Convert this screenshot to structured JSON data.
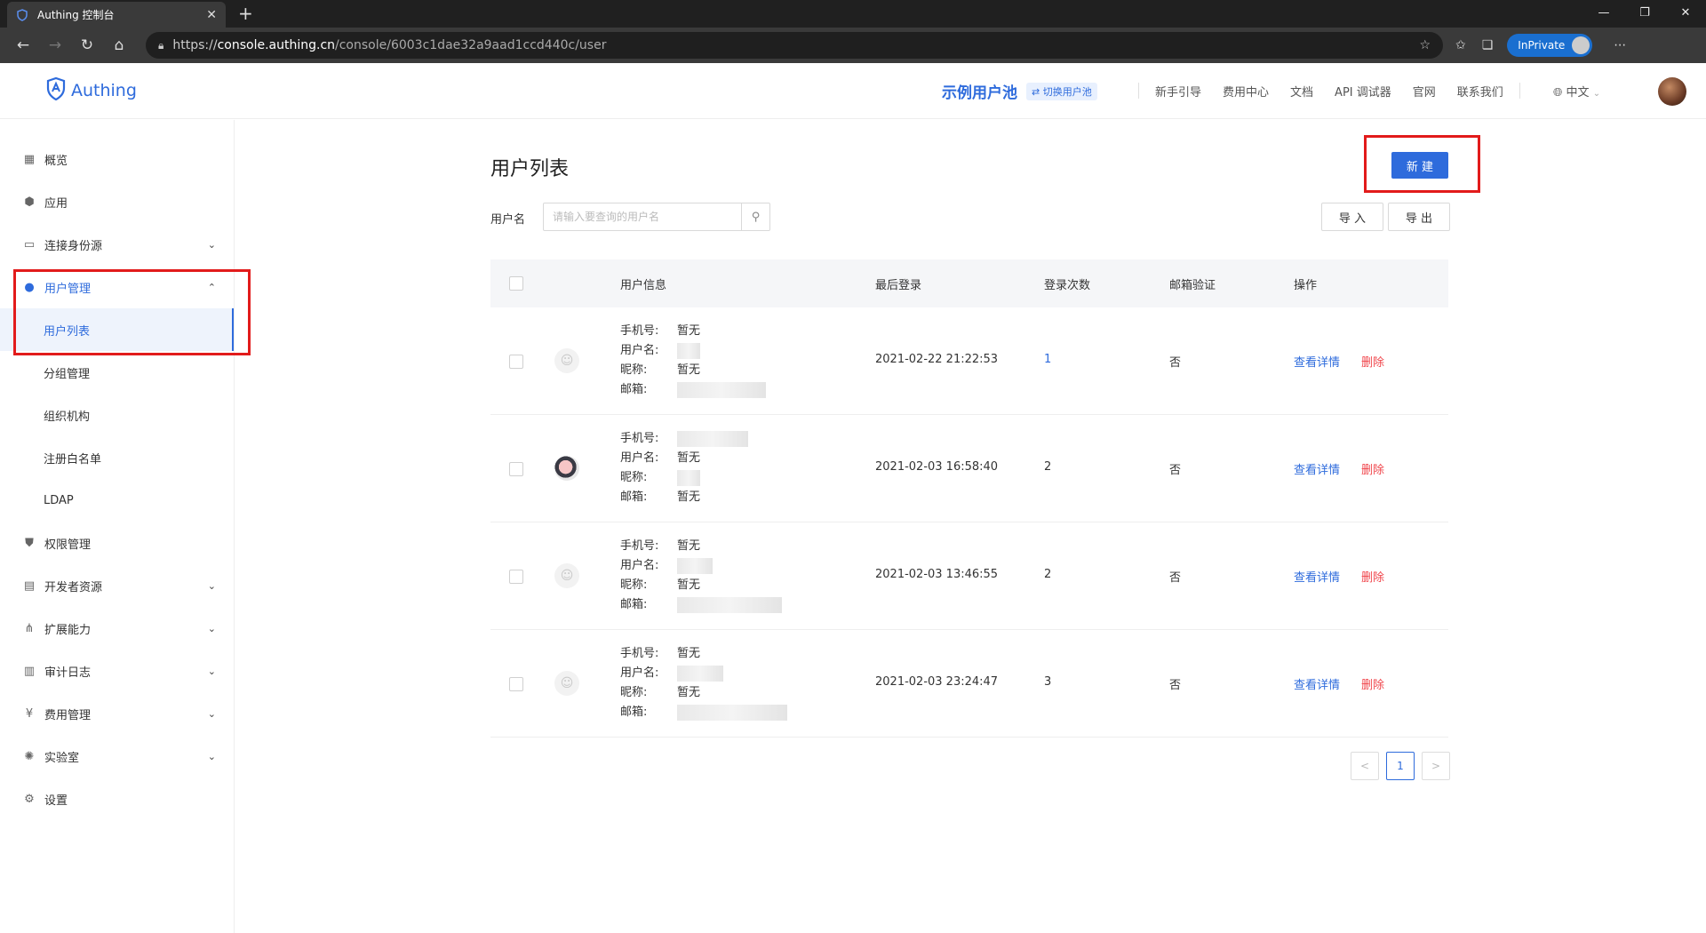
{
  "browser": {
    "tab_title": "Authing 控制台",
    "new_tab": "+",
    "url_scheme": "https://",
    "url_host": "console.authing.cn",
    "url_path": "/console/6003c1dae32a9aad1ccd440c/user",
    "inprivate_label": "InPrivate",
    "win_min": "—",
    "win_restore": "❐",
    "win_close": "✕"
  },
  "header": {
    "logo_text": "Authing",
    "pool_name": "示例用户池",
    "switch_label": "⇄ 切换用户池",
    "nav": [
      "新手引导",
      "费用中心",
      "文档",
      "API 调试器",
      "官网",
      "联系我们"
    ],
    "language": "中文"
  },
  "sidebar": {
    "items": [
      {
        "label": "概览",
        "icon": "dashboard-icon",
        "glyph": "▦"
      },
      {
        "label": "应用",
        "icon": "cube-icon",
        "glyph": "⬢"
      },
      {
        "label": "连接身份源",
        "icon": "id-card-icon",
        "glyph": "▭",
        "chevron": "⌄"
      },
      {
        "label": "用户管理",
        "icon": "user-icon",
        "glyph": "●",
        "chevron": "⌃"
      },
      {
        "label": "权限管理",
        "icon": "shield-icon",
        "glyph": "⛊"
      },
      {
        "label": "开发者资源",
        "icon": "keyboard-icon",
        "glyph": "▤",
        "chevron": "⌄"
      },
      {
        "label": "扩展能力",
        "icon": "share-icon",
        "glyph": "⋔",
        "chevron": "⌄"
      },
      {
        "label": "审计日志",
        "icon": "log-icon",
        "glyph": "▥",
        "chevron": "⌄"
      },
      {
        "label": "费用管理",
        "icon": "yen-icon",
        "glyph": "¥",
        "chevron": "⌄"
      },
      {
        "label": "实验室",
        "icon": "bulb-icon",
        "glyph": "✺",
        "chevron": "⌄"
      },
      {
        "label": "设置",
        "icon": "gear-icon",
        "glyph": "⚙"
      }
    ],
    "user_sub": [
      "用户列表",
      "分组管理",
      "组织机构",
      "注册白名单",
      "LDAP"
    ]
  },
  "main": {
    "title": "用户列表",
    "new_button": "新 建",
    "filter_label": "用户名",
    "search_placeholder": "请输入要查询的用户名",
    "import_button": "导 入",
    "export_button": "导 出",
    "columns": [
      "用户信息",
      "最后登录",
      "登录次数",
      "邮箱验证",
      "操作"
    ],
    "field_labels": {
      "phone": "手机号:",
      "username": "用户名:",
      "nickname": "昵称:",
      "email": "邮箱:"
    },
    "none_text": "暂无",
    "rows": [
      {
        "last_login": "2021-02-22 21:22:53",
        "count": "1",
        "verified": "否",
        "view": "查看详情",
        "delete": "删除"
      },
      {
        "last_login": "2021-02-03 16:58:40",
        "count": "2",
        "verified": "否",
        "view": "查看详情",
        "delete": "删除"
      },
      {
        "last_login": "2021-02-03 13:46:55",
        "count": "2",
        "verified": "否",
        "view": "查看详情",
        "delete": "删除"
      },
      {
        "last_login": "2021-02-03 23:24:47",
        "count": "3",
        "verified": "否",
        "view": "查看详情",
        "delete": "删除"
      }
    ],
    "pager": {
      "prev": "<",
      "page": "1",
      "next": ">"
    }
  },
  "colors": {
    "accent": "#2e6bdc",
    "danger": "#f0454b",
    "highlight": "#e21b1b"
  }
}
